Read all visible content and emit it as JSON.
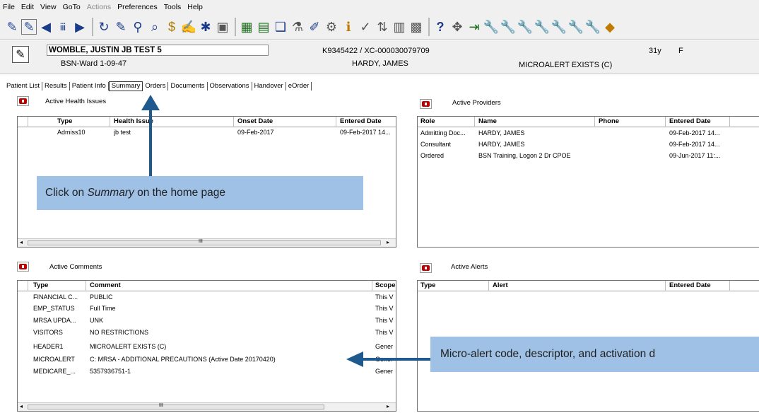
{
  "menu": [
    "File",
    "Edit",
    "View",
    "GoTo",
    "Actions",
    "Preferences",
    "Tools",
    "Help"
  ],
  "patient": {
    "name": "WOMBLE, JUSTIN JB TEST 5",
    "ward": "BSN-Ward 1-09-47",
    "mrn": "K9345422 / XC-000030079709",
    "physician": "HARDY, JAMES",
    "age": "31y",
    "sex": "F",
    "alert": "MICROALERT EXISTS (C)"
  },
  "tabs": [
    "Patient List",
    "Results",
    "Patient Info",
    "Summary",
    "Orders",
    "Documents",
    "Observations",
    "Handover",
    "eOrder"
  ],
  "health_issues": {
    "title": "Active Health Issues",
    "columns": [
      "Type",
      "Health Issue",
      "Onset Date",
      "Entered Date"
    ],
    "rows": [
      {
        "type": "Admiss10",
        "issue": "jb test",
        "onset": "09-Feb-2017",
        "entered": "09-Feb-2017 14..."
      }
    ],
    "scroll_glyph": "III"
  },
  "providers": {
    "title": "Active Providers",
    "columns": [
      "Role",
      "Name",
      "Phone",
      "Entered Date"
    ],
    "rows": [
      {
        "role": "Admitting Doc...",
        "name": "HARDY, JAMES",
        "phone": "",
        "entered": "09-Feb-2017 14..."
      },
      {
        "role": "Consultant",
        "name": "HARDY, JAMES",
        "phone": "",
        "entered": "09-Feb-2017 14..."
      },
      {
        "role": "Ordered",
        "name": "BSN Training, Logon 2 Dr CPOE",
        "phone": "",
        "entered": "09-Jun-2017 11:..."
      }
    ]
  },
  "comments": {
    "title": "Active Comments",
    "columns": [
      "Type",
      "Comment",
      "Scope"
    ],
    "rows": [
      {
        "type": "FINANCIAL C...",
        "comment": "PUBLIC",
        "scope": "This V"
      },
      {
        "type": "EMP_STATUS",
        "comment": "Full Time",
        "scope": "This V"
      },
      {
        "type": "MRSA UPDA...",
        "comment": "UNK",
        "scope": "This V"
      },
      {
        "type": "VISITORS",
        "comment": "NO RESTRICTIONS",
        "scope": "This V"
      },
      {
        "type": "HEADER1",
        "comment": "MICROALERT EXISTS (C)",
        "scope": "Gener"
      },
      {
        "type": "MICROALERT",
        "comment": "C: MRSA - ADDITIONAL PRECAUTIONS (Active Date 20170420)",
        "scope": "Gener"
      },
      {
        "type": "MEDICARE_...",
        "comment": "5357936751-1",
        "scope": "Gener"
      }
    ],
    "scroll_glyph": "III"
  },
  "alerts": {
    "title": "Active Alerts",
    "columns": [
      "Type",
      "Alert",
      "Entered Date"
    ],
    "rows": []
  },
  "callouts": {
    "summary": {
      "prefix": "Click on ",
      "emphasis": "Summary",
      "suffix": " on the home page"
    },
    "microalert": "Micro-alert code, descriptor, and activation d"
  },
  "health_issue_badge": "H",
  "colors": {
    "accent_red": "#c00000",
    "callout": "#9fc1e6",
    "arrow": "#1f5a8f",
    "badge": "#f0c000"
  }
}
